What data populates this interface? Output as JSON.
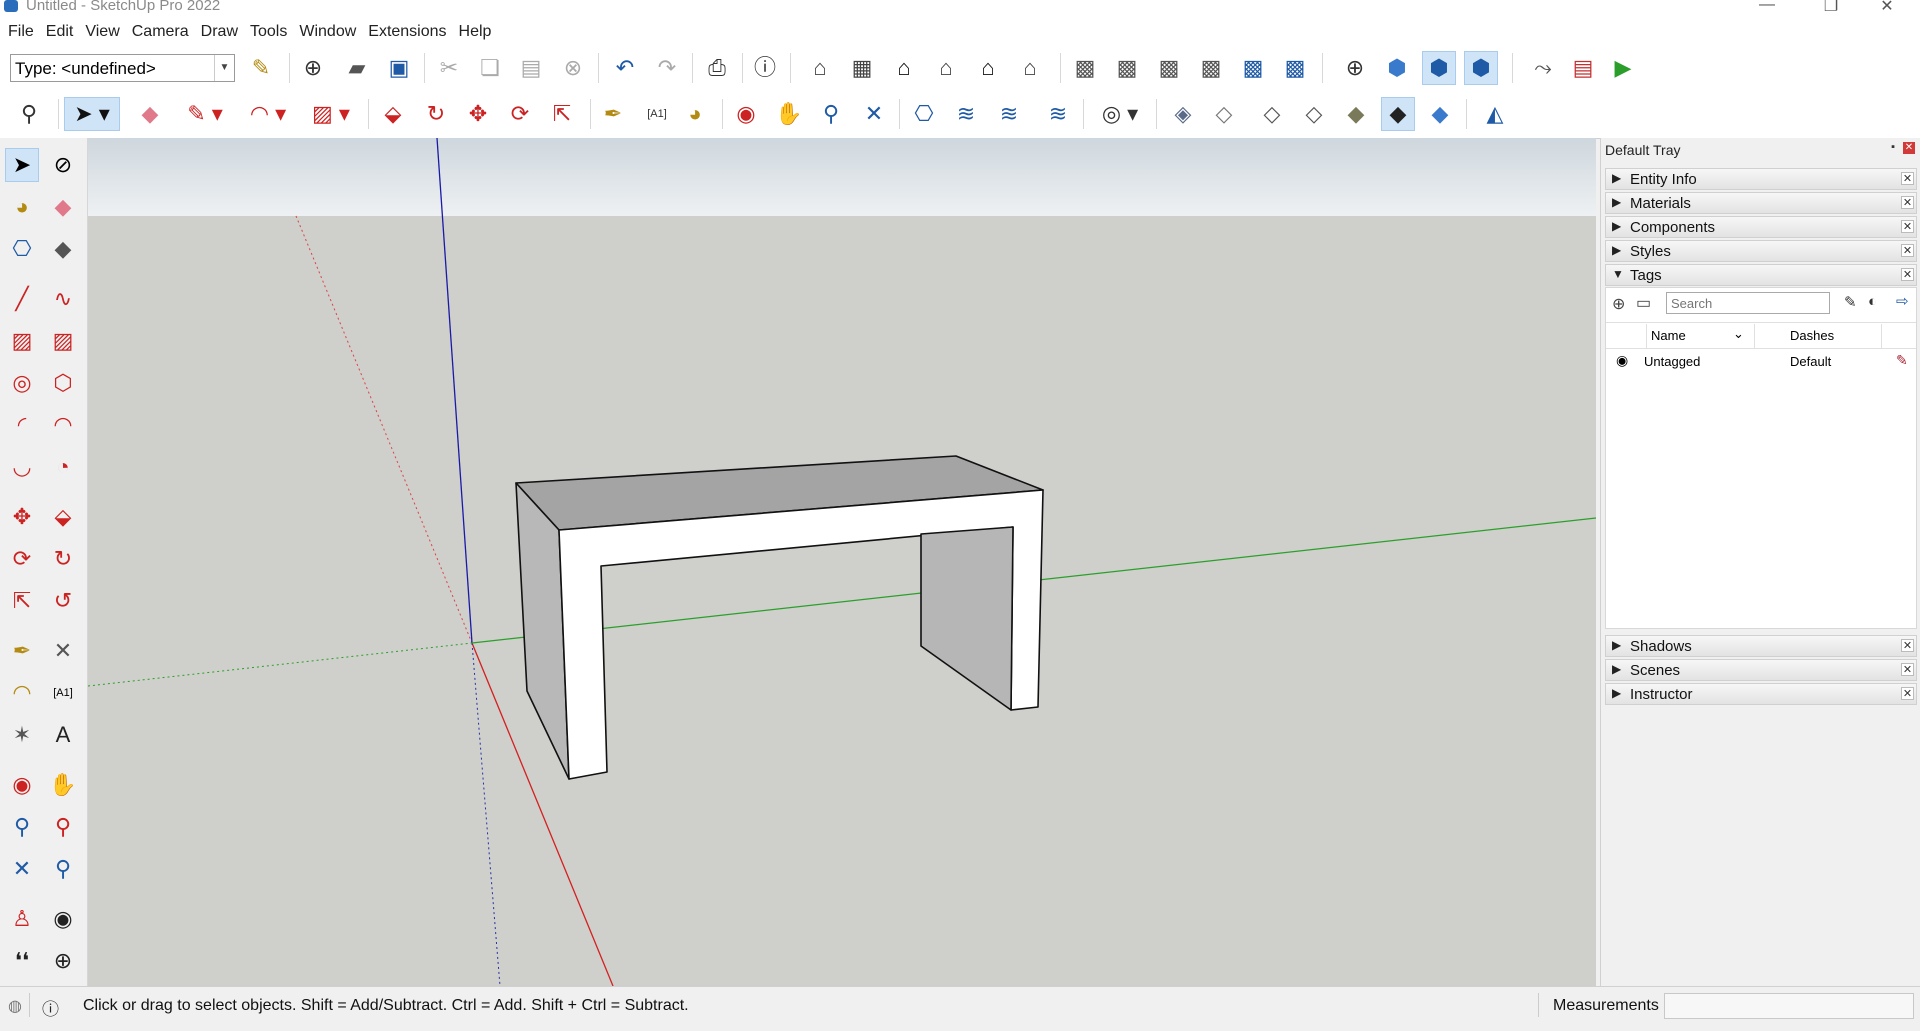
{
  "window": {
    "title": "Untitled - SketchUp Pro 2022"
  },
  "menu": [
    "File",
    "Edit",
    "View",
    "Camera",
    "Draw",
    "Tools",
    "Window",
    "Extensions",
    "Help"
  ],
  "toolbar": {
    "type_value": "Type: <undefined>"
  },
  "tray": {
    "title": "Default Tray",
    "panels_top": [
      {
        "label": "Entity Info",
        "arrow": "▶"
      },
      {
        "label": "Materials",
        "arrow": "▶"
      },
      {
        "label": "Components",
        "arrow": "▶"
      },
      {
        "label": "Styles",
        "arrow": "▶"
      },
      {
        "label": "Tags",
        "arrow": "▼"
      }
    ],
    "tags": {
      "search_placeholder": "Search",
      "col_name": "Name",
      "col_dashes": "Dashes",
      "rows": [
        {
          "name": "Untagged",
          "dashes": "Default"
        }
      ]
    },
    "panels_bottom": [
      {
        "label": "Shadows",
        "arrow": "▶"
      },
      {
        "label": "Scenes",
        "arrow": "▶"
      },
      {
        "label": "Instructor",
        "arrow": "▶"
      }
    ]
  },
  "status": {
    "message": "Click or drag to select objects. Shift = Add/Subtract. Ctrl = Add. Shift + Ctrl = Subtract.",
    "measurements_label": "Measurements"
  },
  "colors": {
    "accent": "#cfe4f7",
    "axis_red": "#d42020",
    "axis_green": "#2aa02a",
    "axis_blue": "#1a1aa8",
    "viewport_bg": "#cfcfcb"
  }
}
